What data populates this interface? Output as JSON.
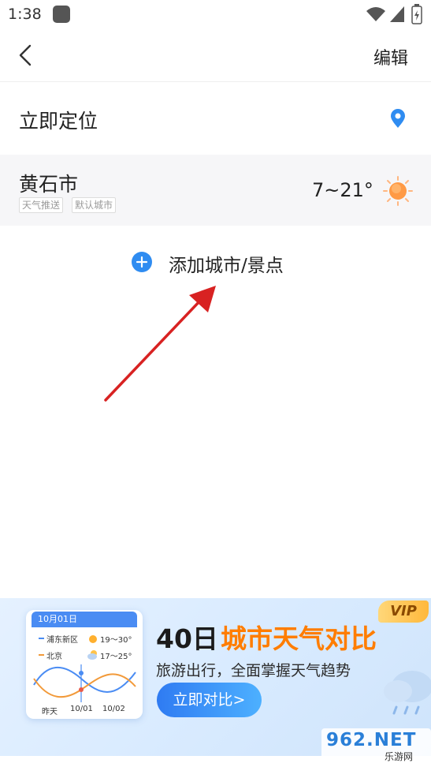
{
  "status_bar": {
    "time": "1:38"
  },
  "nav": {
    "back_icon": "chevron-left-icon",
    "edit_label": "编辑"
  },
  "locate": {
    "label": "立即定位",
    "icon": "location-pin-icon",
    "icon_color": "#2f8cf1"
  },
  "cities": [
    {
      "name": "黄石市",
      "tags": [
        "天气推送",
        "默认城市"
      ],
      "temp": "7~21°",
      "icon": "sun-icon"
    }
  ],
  "add_city": {
    "label": "添加城市/景点",
    "icon": "plus-circle-icon",
    "accent": "#2f8cf1"
  },
  "banner": {
    "card_date": "10月01日",
    "legend": [
      {
        "name": "浦东新区",
        "temp": "19～30°",
        "color": "#4a8cf3"
      },
      {
        "name": "北京",
        "temp": "17～25°",
        "color": "#f29a3a"
      }
    ],
    "x_labels": [
      "昨天",
      "10/01",
      "10/02"
    ],
    "title_prefix": "40日",
    "title_highlight": "城市天气对比",
    "subtitle": "旅游出行，全面掌握天气趋势",
    "button_label": "立即对比>",
    "vip": "VIP"
  },
  "watermark": {
    "main": "962.NET",
    "sub": "乐游网"
  }
}
